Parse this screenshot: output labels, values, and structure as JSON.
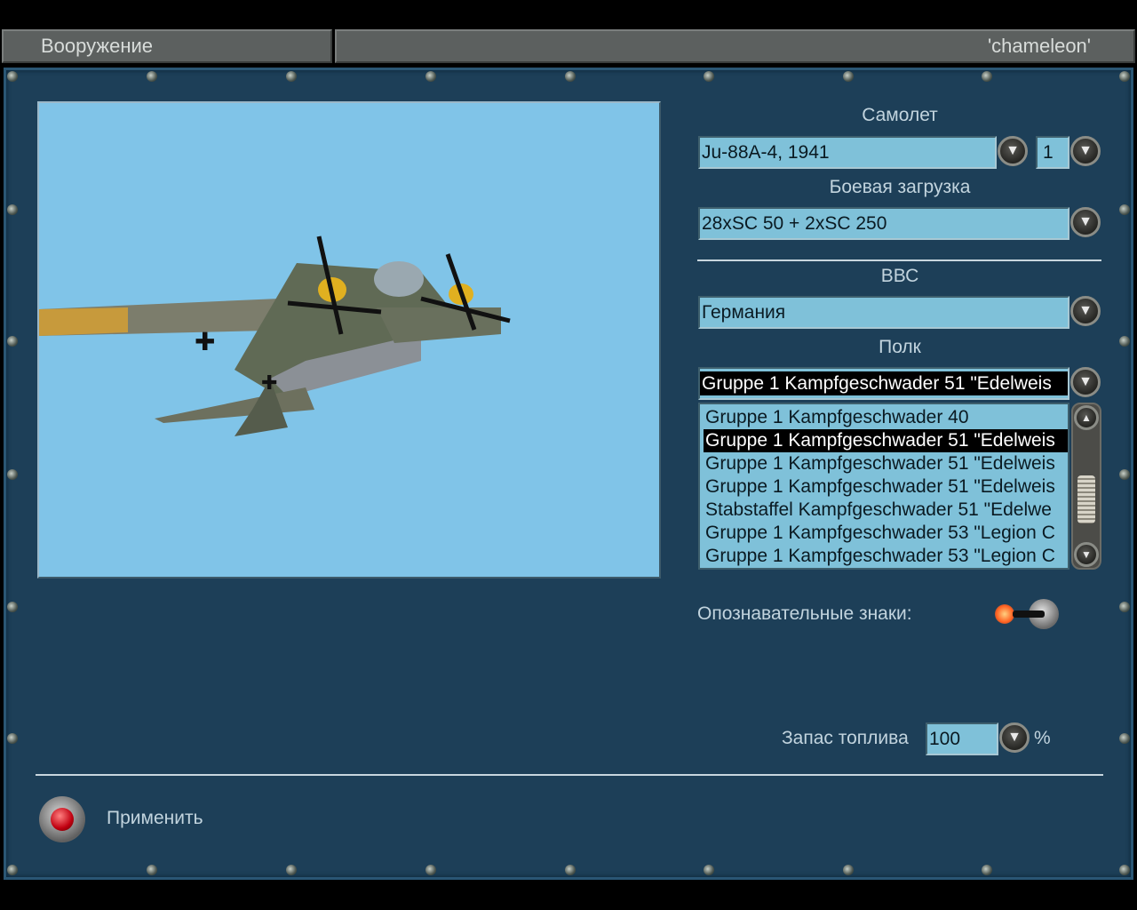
{
  "header": {
    "left_title": "Вооружение",
    "right_title": "'chameleon'"
  },
  "aircraft": {
    "label": "Самолет",
    "value": "Ju-88A-4, 1941",
    "count": "1"
  },
  "loadout": {
    "label": "Боевая загрузка",
    "value": "28xSC 50 + 2xSC 250"
  },
  "air_force": {
    "label": "ВВС",
    "value": "Германия"
  },
  "regiment": {
    "label": "Полк",
    "value": "Gruppe 1 Kampfgeschwader 51 \"Edelweis",
    "options": [
      "Gruppe 1 Kampfgeschwader 40",
      "Gruppe 1 Kampfgeschwader 51 \"Edelweis",
      "Gruppe 1 Kampfgeschwader 51 \"Edelweis",
      "Gruppe 1 Kampfgeschwader 51 \"Edelweis",
      "Stabstaffel Kampfgeschwader 51 \"Edelwe",
      "Gruppe 1 Kampfgeschwader 53 \"Legion C",
      "Gruppe 1 Kampfgeschwader 53 \"Legion C"
    ],
    "selected_index": 1
  },
  "insignia": {
    "label": "Опознавательные знаки:",
    "enabled": true
  },
  "fuel": {
    "label": "Запас топлива",
    "value": "100",
    "unit": "%"
  },
  "apply": {
    "label": "Применить"
  },
  "colors": {
    "panel": "#1d3f58",
    "field": "#7fc1d9",
    "preview_sky": "#80c4e8"
  }
}
